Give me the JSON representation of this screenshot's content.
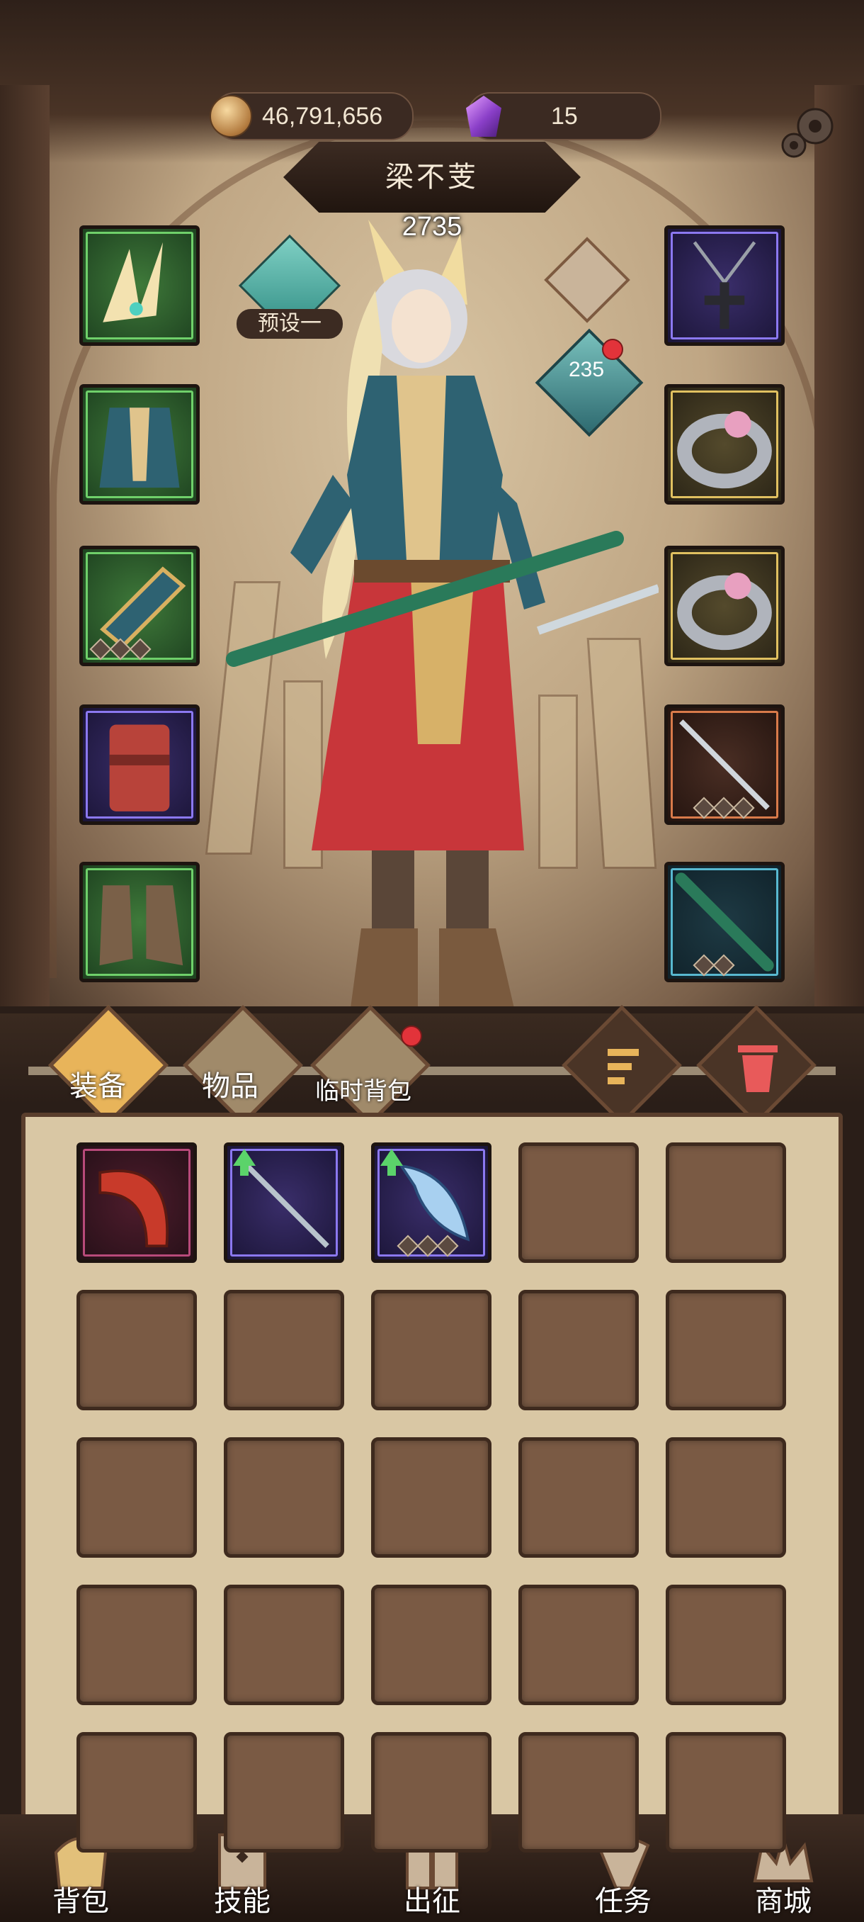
{
  "currency": {
    "gold": "46,791,656",
    "gems": "15"
  },
  "character": {
    "name": "梁不芰",
    "power": "2735",
    "level": "235"
  },
  "preset": {
    "label": "预设一"
  },
  "equipment_left": [
    {
      "name": "headgear",
      "rarity": "green",
      "stars": 0
    },
    {
      "name": "armor",
      "rarity": "green",
      "stars": 0
    },
    {
      "name": "bracer",
      "rarity": "green",
      "stars": 3
    },
    {
      "name": "belt",
      "rarity": "purple",
      "stars": 0
    },
    {
      "name": "boots",
      "rarity": "green",
      "stars": 0
    }
  ],
  "equipment_right": [
    {
      "name": "necklace",
      "rarity": "purple",
      "stars": 0
    },
    {
      "name": "ring-1",
      "rarity": "gold",
      "stars": 0
    },
    {
      "name": "ring-2",
      "rarity": "gold",
      "stars": 0
    },
    {
      "name": "weapon-sword",
      "rarity": "orange",
      "stars": 3
    },
    {
      "name": "weapon-scabbard",
      "rarity": "teal",
      "stars": 2
    }
  ],
  "tabs": {
    "equipment": "装备",
    "items": "物品",
    "temp_bag": "临时背包"
  },
  "inventory": [
    {
      "name": "horn-item",
      "rarity": "red",
      "upgrade": false,
      "stars": 0
    },
    {
      "name": "sword-item",
      "rarity": "purple",
      "upgrade": true,
      "stars": 0
    },
    {
      "name": "blade-item",
      "rarity": "purple",
      "upgrade": true,
      "stars": 3
    }
  ],
  "nav": {
    "bag": "背包",
    "skills": "技能",
    "expedition": "出征",
    "tasks": "任务",
    "shop": "商城"
  }
}
